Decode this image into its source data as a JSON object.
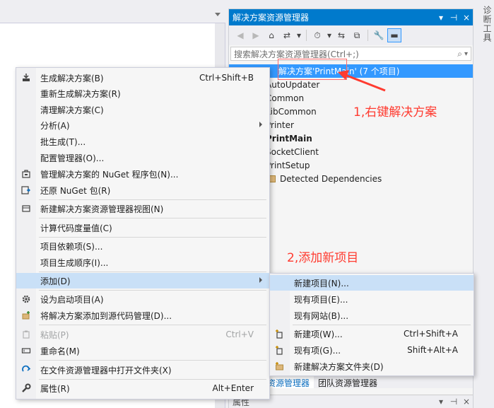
{
  "panel": {
    "title": "解决方案资源管理器",
    "pin_glyph": "▾",
    "pin2_glyph": "⊣",
    "close_glyph": "×",
    "search_placeholder": "搜索解决方案资源管理器(Ctrl+;)",
    "search_glyph": "⌕",
    "search_drop_glyph": "▾"
  },
  "toolbar": {
    "back": "◀",
    "forward": "▶",
    "home": "⌂",
    "sync": "⇄",
    "drop1": "▾",
    "history": "⏱",
    "drop2": "▾",
    "switch": "⇆",
    "collapse": "⧉",
    "wrench": "🔧",
    "preview": "▬"
  },
  "tree": {
    "root": "解决方案'PrintMain' (7 个项目)",
    "items": [
      {
        "label": "AutoUpdater",
        "bold": false
      },
      {
        "label": "Common",
        "bold": false
      },
      {
        "label": "LibCommon",
        "bold": false
      },
      {
        "label": "Printer",
        "bold": false
      },
      {
        "label": "PrintMain",
        "bold": true
      },
      {
        "label": "SocketClient",
        "bold": false
      },
      {
        "label": "PrintSetup",
        "bold": false
      }
    ],
    "detected": "Detected Dependencies"
  },
  "bottom_tabs": {
    "solution": "解决方案资源管理器",
    "team": "团队资源管理器"
  },
  "properties": {
    "title": "属性",
    "pin": "▾",
    "pin2": "⊣",
    "close": "×"
  },
  "vertical_tab": "诊断工具",
  "menu": {
    "build": {
      "label": "生成解决方案(B)",
      "shortcut": "Ctrl+Shift+B"
    },
    "rebuild": {
      "label": "重新生成解决方案(R)"
    },
    "clean": {
      "label": "清理解决方案(C)"
    },
    "analyze": {
      "label": "分析(A)"
    },
    "batch": {
      "label": "批生成(T)..."
    },
    "config": {
      "label": "配置管理器(O)..."
    },
    "nuget": {
      "label": "管理解决方案的 NuGet 程序包(N)..."
    },
    "restore": {
      "label": "还原 NuGet 包(R)"
    },
    "newview": {
      "label": "新建解决方案资源管理器视图(N)"
    },
    "metrics": {
      "label": "计算代码度量值(C)"
    },
    "deps": {
      "label": "项目依赖项(S)..."
    },
    "order": {
      "label": "项目生成顺序(I)..."
    },
    "add": {
      "label": "添加(D)"
    },
    "startup": {
      "label": "设为启动项目(A)"
    },
    "scm": {
      "label": "将解决方案添加到源代码管理(D)..."
    },
    "paste": {
      "label": "粘贴(P)",
      "shortcut": "Ctrl+V"
    },
    "rename": {
      "label": "重命名(M)"
    },
    "openfolder": {
      "label": "在文件资源管理器中打开文件夹(X)"
    },
    "props": {
      "label": "属性(R)",
      "shortcut": "Alt+Enter"
    }
  },
  "submenu": {
    "newproject": {
      "label": "新建项目(N)..."
    },
    "existingproject": {
      "label": "现有项目(E)..."
    },
    "existingsite": {
      "label": "现有网站(B)..."
    },
    "newitem": {
      "label": "新建项(W)...",
      "shortcut": "Ctrl+Shift+A"
    },
    "existingitem": {
      "label": "现有项(G)...",
      "shortcut": "Shift+Alt+A"
    },
    "newfolder": {
      "label": "新建解决方案文件夹(D)"
    }
  },
  "annotations": {
    "step1": "1,右键解决方案",
    "step2": "2,添加新项目"
  },
  "colors": {
    "accent": "#007acc",
    "selection": "#3399ff",
    "highlight": "#c9e0f7",
    "annotation": "#ff3b30"
  }
}
